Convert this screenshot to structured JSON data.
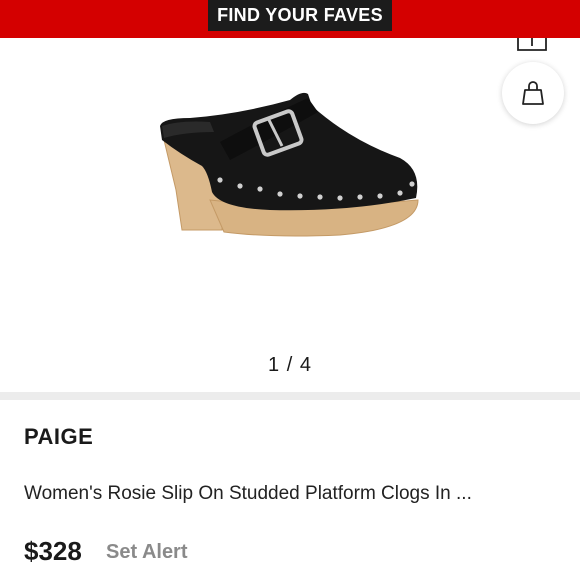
{
  "banner": {
    "label": "FIND YOUR FAVES",
    "background": "#d40000",
    "pill_color": "#1c1c1c"
  },
  "icons": {
    "share": "share-icon",
    "bag": "shopping-bag-icon"
  },
  "gallery": {
    "pager_text": "1 / 4"
  },
  "product": {
    "brand": "PAIGE",
    "title": "Women's Rosie Slip On Studded Platform Clogs In ...",
    "price": "$328",
    "set_alert_label": "Set Alert"
  }
}
